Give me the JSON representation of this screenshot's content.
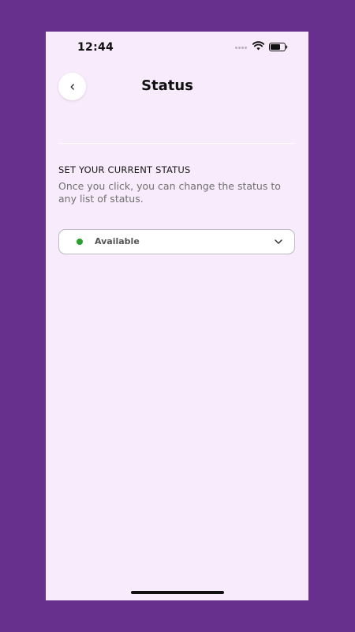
{
  "status_bar": {
    "time": "12:44"
  },
  "header": {
    "title": "Status",
    "back_icon": "chevron-left-icon"
  },
  "status_section": {
    "heading": "SET YOUR CURRENT STATUS",
    "description": "Once you click, you can change the status to any list of status."
  },
  "status_select": {
    "value": "Available",
    "indicator_color": "#2aa12e",
    "expand_icon": "chevron-down-icon"
  },
  "colors": {
    "background": "#66308c",
    "screen": "#f8ebfb"
  }
}
